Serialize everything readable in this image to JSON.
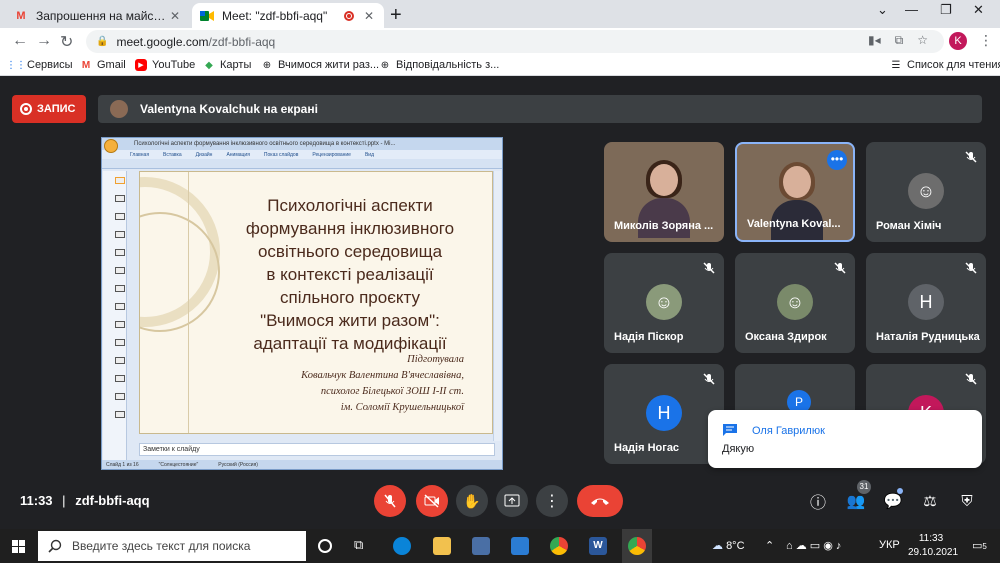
{
  "browser": {
    "tabs": [
      {
        "title": "Запрошення на майстер-клас о",
        "icon": "gmail-icon"
      },
      {
        "title": "Meet: \"zdf-bbfi-aqq\"",
        "icon": "meet-icon",
        "active": true
      }
    ],
    "url_host": "meet.google.com",
    "url_path": "/zdf-bbfi-aqq",
    "profile_initial": "K",
    "bookmarks": [
      "Сервисы",
      "Gmail",
      "YouTube",
      "Карты",
      "Вчимося жити раз...",
      "Відповідальність з..."
    ],
    "reading_list": "Список для чтения"
  },
  "meet": {
    "record_label": "ЗАПИС",
    "presenting_text": "Valentyna Kovalchuk на екрані",
    "time": "11:33",
    "meeting_code": "zdf-bbfi-aqq",
    "participants_count": "31",
    "participants": [
      {
        "name": "Миколів Зоряна ...",
        "type": "video"
      },
      {
        "name": "Valentyna Koval...",
        "type": "video"
      },
      {
        "name": "Роман Хіміч",
        "type": "photo"
      },
      {
        "name": "Надія Піскор",
        "type": "photo"
      },
      {
        "name": "Оксана Здирок",
        "type": "photo"
      },
      {
        "name": "Наталія Рудницька",
        "initial": "Н"
      },
      {
        "name": "Надія Ногас",
        "initial": "Н"
      },
      {
        "initial": "P"
      },
      {
        "initial": "K"
      }
    ],
    "chat": {
      "sender": "Оля Гаврилюк",
      "message": "Дякую"
    }
  },
  "slide_window": {
    "title": "Психологічні аспекти формування інклюзивного освітнього середовища в контексті.pptx - Mi...",
    "menu": [
      "Главная",
      "Вставка",
      "Дизайн",
      "Анимация",
      "Показ слайдов",
      "Рецензирование",
      "Вид"
    ],
    "slide_title": [
      "Психологічні аспекти",
      "формування інклюзивного",
      "освітнього середовища",
      "в контексті реалізації",
      "спільного проєкту",
      "\"Вчимося жити разом\":",
      "адаптації та модифікації"
    ],
    "author_lines": [
      "Підготувала",
      "Ковальчук  Валентина В'ячеславівна,",
      "психолог Білецької ЗОШ І-ІІ ст.",
      "ім. Соломії Крушельницької"
    ],
    "notes_placeholder": "Заметки к слайду",
    "status": [
      "Слайд 1 из 16",
      "\"Солнцестояние\"",
      "Русский (Россия)"
    ]
  },
  "taskbar": {
    "search_placeholder": "Введите здесь текст для поиска",
    "weather": "8°C",
    "lang": "УКР",
    "time": "11:33",
    "date": "29.10.2021",
    "notifications": "5"
  },
  "colors": {
    "meet_bg": "#202124",
    "tile_bg": "#3c4043",
    "red": "#ea4335",
    "blue": "#1a73e8"
  }
}
